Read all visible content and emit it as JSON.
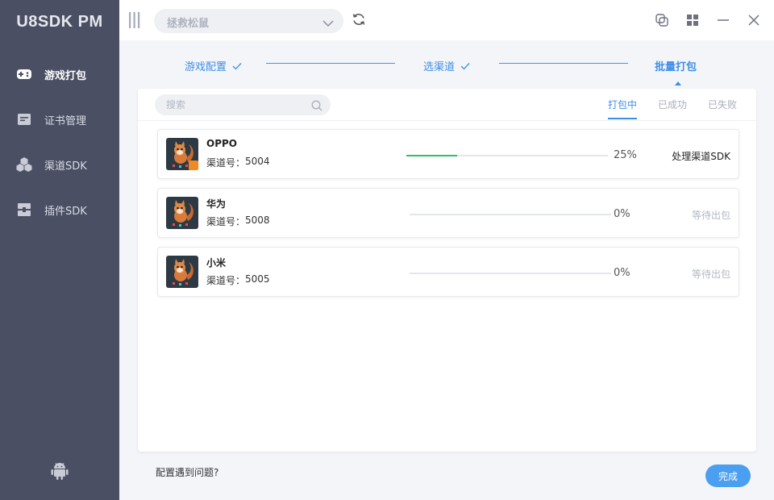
{
  "app": {
    "title": "U8SDK PM"
  },
  "sidebar": {
    "items": [
      {
        "label": "游戏打包",
        "icon": "gamepad-icon",
        "active": true
      },
      {
        "label": "证书管理",
        "icon": "certificate-icon",
        "active": false
      },
      {
        "label": "渠道SDK",
        "icon": "cubes-icon",
        "active": false
      },
      {
        "label": "插件SDK",
        "icon": "plugin-icon",
        "active": false
      }
    ],
    "bottom_icon": "android-icon"
  },
  "topbar": {
    "project_select": {
      "value": "拯救松鼠"
    },
    "icons": [
      "menu-icon",
      "chevron-down-icon",
      "refresh-icon",
      "copy-window-icon",
      "grid-icon",
      "minimize-icon",
      "close-icon"
    ]
  },
  "steps": [
    {
      "label": "游戏配置",
      "done": true
    },
    {
      "label": "选渠道",
      "done": true
    },
    {
      "label": "批量打包",
      "done": false,
      "current": true
    }
  ],
  "search": {
    "placeholder": "搜索"
  },
  "tabs": [
    {
      "label": "打包中",
      "active": true
    },
    {
      "label": "已成功",
      "active": false
    },
    {
      "label": "已失败",
      "active": false
    }
  ],
  "channels": [
    {
      "name": "OPPO",
      "channel_label": "渠道号：",
      "channel_id": "5004",
      "progress": 25,
      "progress_text": "25%",
      "status": "处理渠道SDK",
      "waiting": false
    },
    {
      "name": "华为",
      "channel_label": "渠道号：",
      "channel_id": "5008",
      "progress": 0,
      "progress_text": "0%",
      "status": "等待出包",
      "waiting": true
    },
    {
      "name": "小米",
      "channel_label": "渠道号：",
      "channel_id": "5005",
      "progress": 0,
      "progress_text": "0%",
      "status": "等待出包",
      "waiting": true
    }
  ],
  "footer": {
    "help_link": "配置遇到问题?",
    "done_button": "完成"
  },
  "colors": {
    "accent": "#3f8ee8",
    "sidebar": "#4a4f63",
    "progress": "#2cbf6a",
    "button": "#4a9ff0"
  }
}
